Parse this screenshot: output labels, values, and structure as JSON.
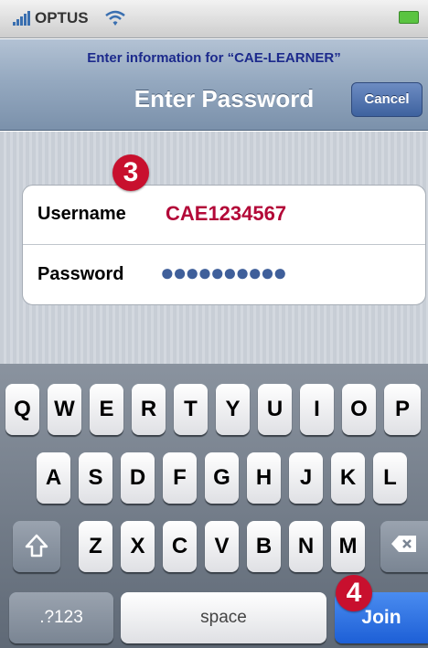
{
  "status_bar": {
    "carrier": "OPTUS",
    "signal_icon": "signal-bars-icon",
    "wifi_icon": "wifi-icon",
    "battery_icon": "battery-icon",
    "battery_color": "#5ac441"
  },
  "header": {
    "prompt": "Enter information for “CAE-LEARNER”",
    "title": "Enter Password",
    "cancel_label": "Cancel",
    "prompt_color": "#1c2a8c"
  },
  "form": {
    "username_label": "Username",
    "username_value": "CAE1234567",
    "password_label": "Password",
    "password_value": "●●●●●●●●●●",
    "username_color": "#b30838"
  },
  "badges": {
    "step3": "3",
    "step4": "4",
    "badge_color": "#c8102e"
  },
  "keyboard": {
    "row1": [
      "Q",
      "W",
      "E",
      "R",
      "T",
      "Y",
      "U",
      "I",
      "O",
      "P"
    ],
    "row2": [
      "A",
      "S",
      "D",
      "F",
      "G",
      "H",
      "J",
      "K",
      "L"
    ],
    "row3": [
      "Z",
      "X",
      "C",
      "V",
      "B",
      "N",
      "M"
    ],
    "shift_icon": "shift-arrow-icon",
    "delete_icon": "backspace-icon",
    "numbers_label": ".?123",
    "space_label": "space",
    "join_label": "Join",
    "join_color": "#1d5fd6"
  }
}
